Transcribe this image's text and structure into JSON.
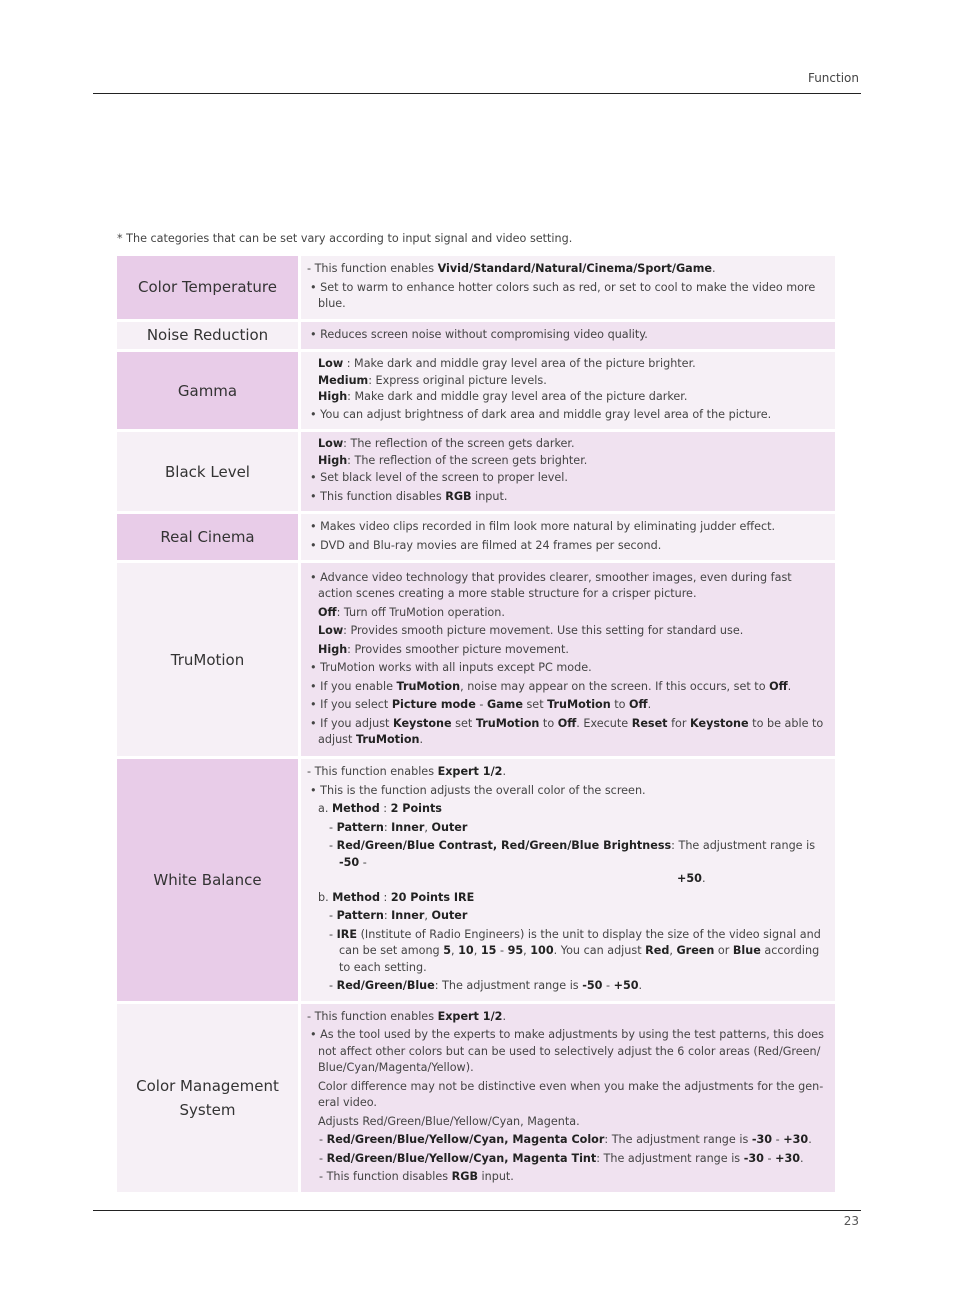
{
  "header": {
    "section": "Function"
  },
  "footer": {
    "page_number": "23"
  },
  "note": "* The categories that can be set vary according to input signal and video setting.",
  "rows": [
    {
      "label": "Color Temperature",
      "lines": [
        {
          "type": "dash",
          "html": "- This function enables <b>Vivid/Standard/Natural/Cinema/Sport/Game</b>."
        },
        {
          "type": "bullet",
          "html": "• Set to warm to enhance hotter colors such as red, or set to cool to make the video more blue."
        }
      ]
    },
    {
      "label": "Noise Reduction",
      "lines": [
        {
          "type": "bullet",
          "html": "• Reduces screen noise without compromising video quality."
        }
      ]
    },
    {
      "label": "Gamma",
      "lines": [
        {
          "type": "indent2",
          "html": "<b>Low</b> : Make dark and middle gray level area of the picture brighter."
        },
        {
          "type": "indent2",
          "html": "<b>Medium</b>: Express original picture levels."
        },
        {
          "type": "indent2",
          "html": "<b>High</b>: Make dark and middle gray level area of the picture darker."
        },
        {
          "type": "bullet",
          "html": "• You can adjust brightness of dark area and middle gray level area of the picture."
        }
      ]
    },
    {
      "label": "Black Level",
      "lines": [
        {
          "type": "indent2",
          "html": "<b>Low</b>: The reflection of the screen gets darker."
        },
        {
          "type": "indent2",
          "html": "<b>High</b>: The reflection of the screen gets brighter."
        },
        {
          "type": "bullet",
          "html": "• Set black level of the screen to proper level."
        },
        {
          "type": "bullet",
          "html": "• This function disables <b>RGB</b> input."
        }
      ]
    },
    {
      "label": "Real Cinema",
      "lines": [
        {
          "type": "bullet",
          "html": "• Makes video clips recorded in film look more natural by eliminating judder effect."
        },
        {
          "type": "bullet",
          "html": "• DVD and Blu-ray movies are filmed at 24 frames per second."
        }
      ]
    },
    {
      "label": "TruMotion",
      "lines": [
        {
          "type": "bullet",
          "html": "• Advance video technology that provides clearer, smoother images, even during fast action scenes creating a more stable structure for a crisper picture."
        },
        {
          "type": "indent1",
          "html": "<b>Off</b>: Turn off TruMotion operation."
        },
        {
          "type": "indent1",
          "html": "<b>Low</b>: Provides smooth picture movement. Use this setting for standard use."
        },
        {
          "type": "indent1",
          "html": "<b>High</b>: Provides smoother picture movement."
        },
        {
          "type": "bullet",
          "html": "• TruMotion works with all inputs except PC mode."
        },
        {
          "type": "bullet",
          "html": "• If you enable <b>TruMotion</b>, noise may appear on the screen. If this occurs, set to <b>Off</b>."
        },
        {
          "type": "bullet",
          "html": "• If you select <b>Picture mode</b> - <b>Game</b> set <b>TruMotion</b> to <b>Off</b>."
        },
        {
          "type": "bullet",
          "html": "• If you adjust <b>Keystone</b> set <b>TruMotion</b> to <b>Off</b>. Execute <b>Reset</b> for <b>Keystone</b> to be able to adjust <b>TruMotion</b>."
        }
      ]
    },
    {
      "label": "White Balance",
      "lines": [
        {
          "type": "dash",
          "html": "- This function enables <b>Expert 1/2</b>."
        },
        {
          "type": "bullet",
          "html": "• This is the function adjusts the overall color of the screen."
        },
        {
          "type": "sub-a",
          "html": "a. <b>Method</b> : <b>2 Points</b>"
        },
        {
          "type": "sub-dash",
          "html": "- <b>Pattern</b>: <b>Inner</b>, <b>Outer</b>"
        },
        {
          "type": "wb-range",
          "html": "- <b>Red/Green/Blue Contrast, Red/Green/Blue Brightness</b>: The adjustment range is <b>-50</b> -<span class=\"tail\"><b>+50</b>.</span>"
        },
        {
          "type": "sub-a",
          "html": "b. <b>Method</b> : <b>20 Points IRE</b>"
        },
        {
          "type": "sub-dash",
          "html": "- <b>Pattern</b>: <b>Inner</b>, <b>Outer</b>"
        },
        {
          "type": "sub-dash",
          "html": "- <b>IRE</b> (Institute of Radio Engineers) is the unit to display the size of the video signal and can be set among <b>5</b>, <b>10</b>, <b>15</b> - <b>95</b>, <b>100</b>. You can adjust <b>Red</b>, <b>Green</b> or <b>Blue</b> according to each setting."
        },
        {
          "type": "sub-dash",
          "html": "- <b>Red/Green/Blue</b>: The adjustment range is <b>-50</b> - <b>+50</b>."
        }
      ]
    },
    {
      "label": "Color Management System",
      "lines": [
        {
          "type": "dash",
          "html": "- This function enables <b>Expert 1/2</b>."
        },
        {
          "type": "bullet",
          "html": "• As the tool used by the experts to make adjustments by using the test patterns, this does not affect other colors but can be used to selectively adjust the 6 color areas (Red/Green/ Blue/Cyan/Magenta/Yellow)."
        },
        {
          "type": "cms-plain",
          "html": "Color difference may not be distinctive even when you make the adjustments for the gen-eral video."
        },
        {
          "type": "cms-plain",
          "html": "Adjusts Red/Green/Blue/Yellow/Cyan, Magenta."
        },
        {
          "type": "cms-dash",
          "html": "- <b>Red/Green/Blue/Yellow/Cyan, Magenta Color</b>: The adjustment range is <b>-30</b> - <b>+30</b>."
        },
        {
          "type": "cms-dash",
          "html": "- <b>Red/Green/Blue/Yellow/Cyan, Magenta Tint</b>: The adjustment range is <b>-30</b> - <b>+30</b>."
        },
        {
          "type": "cms-dash",
          "html": "- This function disables <b>RGB</b> input."
        }
      ]
    }
  ]
}
